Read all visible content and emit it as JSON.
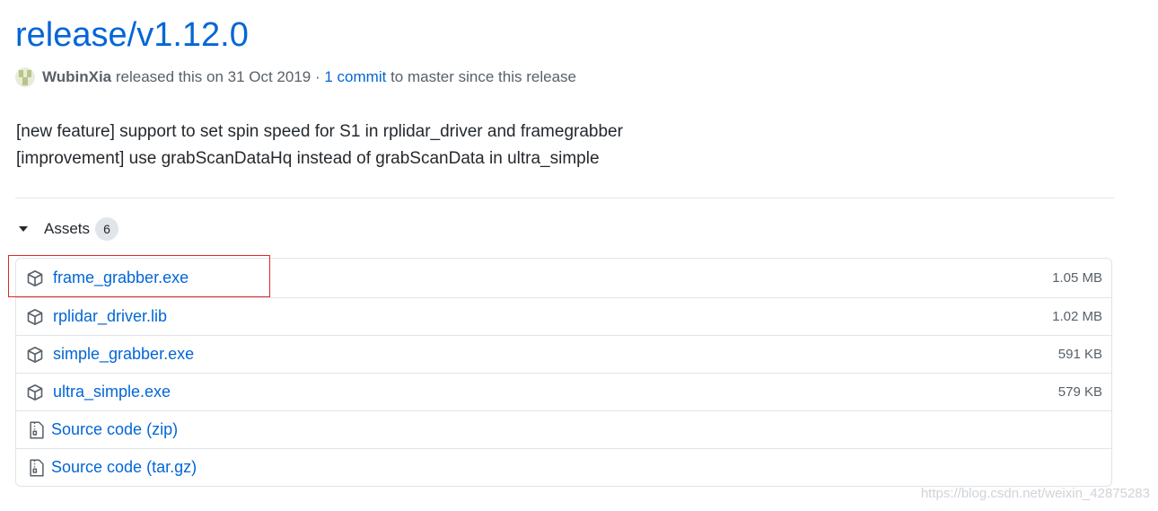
{
  "release": {
    "title": "release/v1.12.0",
    "author": "WubinXia",
    "released_text": "released this on 31 Oct 2019 ·",
    "commit_link": "1 commit",
    "commit_suffix": "to master since this release"
  },
  "notes": [
    "[new feature] support to set spin speed for S1 in rplidar_driver and framegrabber",
    "[improvement] use grabScanDataHq instead of grabScanData in ultra_simple"
  ],
  "assets": {
    "label": "Assets",
    "count": "6",
    "files": [
      {
        "name": "frame_grabber.exe",
        "size": "1.05 MB",
        "icon": "package-icon"
      },
      {
        "name": "rplidar_driver.lib",
        "size": "1.02 MB",
        "icon": "package-icon"
      },
      {
        "name": "simple_grabber.exe",
        "size": "591 KB",
        "icon": "package-icon"
      },
      {
        "name": "ultra_simple.exe",
        "size": "579 KB",
        "icon": "package-icon"
      }
    ],
    "source": [
      {
        "name": "Source code",
        "ext": "(zip)",
        "icon": "file-zip-icon"
      },
      {
        "name": "Source code",
        "ext": "(tar.gz)",
        "icon": "file-zip-icon"
      }
    ]
  },
  "watermark": "https://blog.csdn.net/weixin_42875283",
  "colors": {
    "link": "#0366d6",
    "muted": "#586069",
    "border": "#e1e4e8",
    "highlight": "#e02727"
  }
}
